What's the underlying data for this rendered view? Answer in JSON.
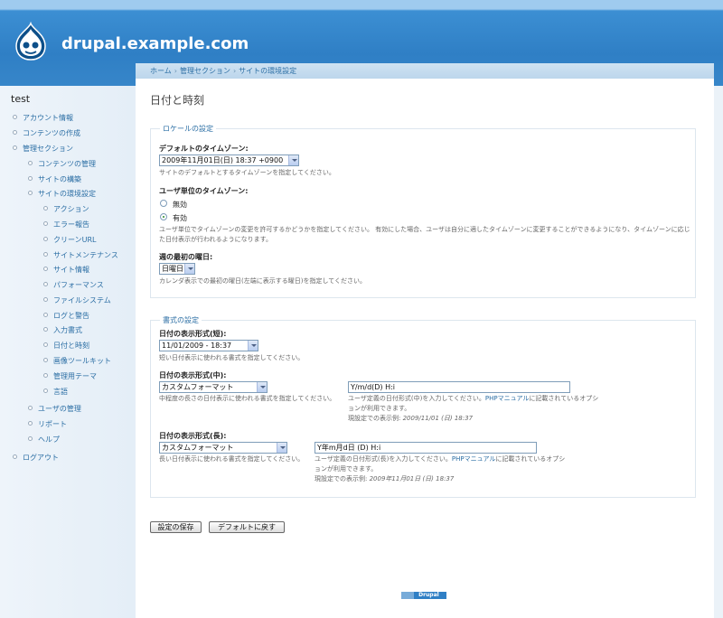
{
  "site": {
    "name": "drupal.example.com"
  },
  "user": {
    "name": "test"
  },
  "nav": {
    "account": "アカウント情報",
    "create_content": "コンテンツの作成",
    "admin": "管理セクション",
    "content_manage": "コンテンツの管理",
    "site_build": "サイトの構築",
    "site_config": "サイトの環境設定",
    "actions": "アクション",
    "error_reports": "エラー報告",
    "clean_url": "クリーンURL",
    "maintenance": "サイトメンテナンス",
    "site_info": "サイト情報",
    "performance": "パフォーマンス",
    "file_system": "ファイルシステム",
    "logging": "ログと警告",
    "input_formats": "入力書式",
    "date_time": "日付と時刻",
    "image_toolkit": "画像ツールキット",
    "admin_theme": "管理用テーマ",
    "language": "言語",
    "user_manage": "ユーザの管理",
    "reports": "リポート",
    "help": "ヘルプ",
    "logout": "ログアウト"
  },
  "breadcrumb": {
    "home": "ホーム",
    "admin": "管理セクション",
    "site_config": "サイトの環境設定",
    "sep": "›"
  },
  "page": {
    "title": "日付と時刻"
  },
  "locale": {
    "legend": "ロケールの設定",
    "tz_label": "デフォルトのタイムゾーン:",
    "tz_value": "2009年11月01日(日) 18:37 +0900",
    "tz_desc": "サイトのデフォルトとするタイムゾーンを指定してください。",
    "user_tz_label": "ユーザ単位のタイムゾーン:",
    "opt_disabled": "無効",
    "opt_enabled": "有効",
    "user_tz_desc": "ユーザ単位でタイムゾーンの変更を許可するかどうかを指定してください。 有効にした場合、ユーザは自分に適したタイムゾーンに変更することができるようになり、タイムゾーンに応じた日付表示が行われるようになります。",
    "week_label": "週の最初の曜日:",
    "week_value": "日曜日",
    "week_desc": "カレンダ表示での最初の曜日(左端に表示する曜日)を指定してください。"
  },
  "formats": {
    "legend": "書式の設定",
    "short_label": "日付の表示形式(短):",
    "short_value": "11/01/2009 - 18:37",
    "short_desc": "短い日付表示に使われる書式を指定してください。",
    "medium_label": "日付の表示形式(中):",
    "medium_select": "カスタムフォーマット",
    "medium_desc": "中程度の長さの日付表示に使われる書式を指定してください。",
    "medium_custom": "Y/m/d(D) H:i",
    "medium_custom_desc_a": "ユーザ定義の日付形式(中)を入力してください。",
    "php_manual": "PHPマニュアル",
    "medium_custom_desc_b": "に記載されているオプシ",
    "medium_custom_desc_c": "ョンが利用できます。",
    "medium_example_label": "現設定での表示例:",
    "medium_example": "2009/11/01 (日) 18:37",
    "long_label": "日付の表示形式(長):",
    "long_select": "カスタムフォーマット",
    "long_desc": "長い日付表示に使われる書式を指定してください。",
    "long_custom": "Y年m月d日 (D) H:i",
    "long_custom_desc_a": "ユーザ定義の日付形式(長)を入力してください。",
    "long_custom_desc_b": "に記載されているオプシ",
    "long_custom_desc_c": "ョンが利用できます。",
    "long_example_label": "現設定での表示例:",
    "long_example": "2009年11月01日 (日) 18:37"
  },
  "buttons": {
    "save": "設定の保存",
    "reset": "デフォルトに戻す"
  },
  "footer": {
    "powered": "Drupal"
  },
  "colors": {
    "header": "#2f7fc5",
    "link": "#2b6ea4",
    "sidebar": "#eef4fa"
  }
}
